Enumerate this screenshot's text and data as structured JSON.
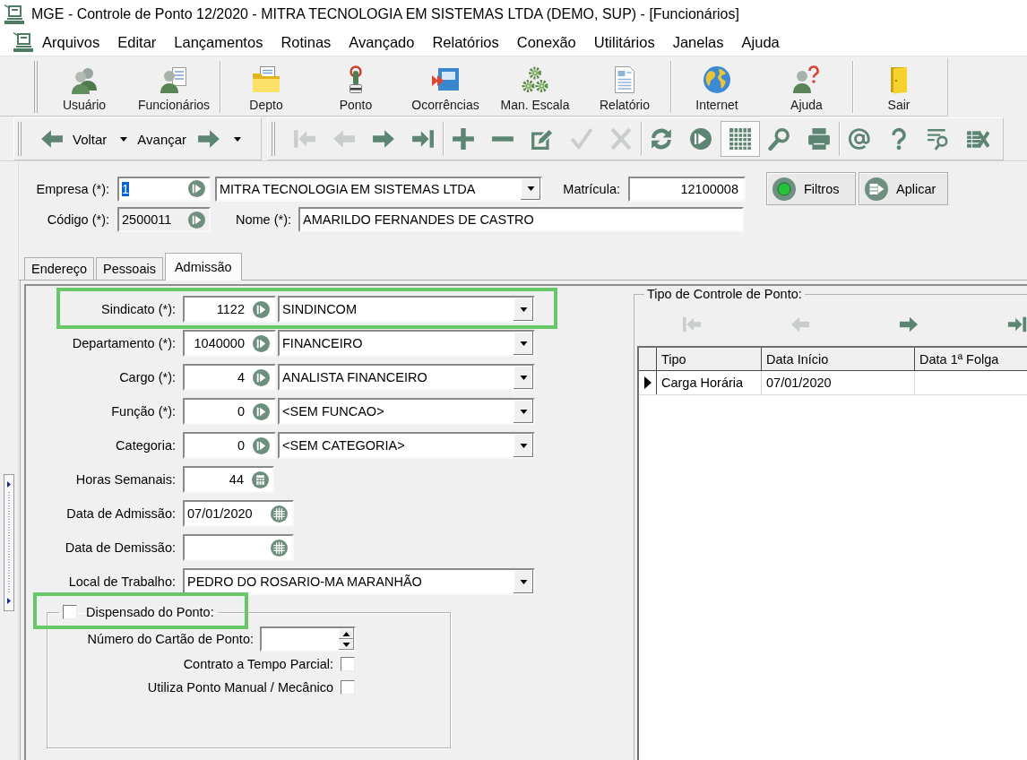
{
  "window": {
    "title": "MGE - Controle de Ponto 12/2020 - MITRA TECNOLOGIA EM SISTEMAS LTDA (DEMO, SUP) - [Funcionários]"
  },
  "menu": [
    "Arquivos",
    "Editar",
    "Lançamentos",
    "Rotinas",
    "Avançado",
    "Relatórios",
    "Conexão",
    "Utilitários",
    "Janelas",
    "Ajuda"
  ],
  "main_toolbar": [
    [
      "Usuário",
      "Funcionários"
    ],
    [
      "Depto",
      "Ponto",
      "Ocorrências",
      "Man. Escala",
      "Relatório"
    ],
    [
      "Internet",
      "Ajuda"
    ],
    [
      "Sair"
    ]
  ],
  "nav_toolbar": {
    "history": [
      {
        "kind": "back",
        "label": "Voltar"
      },
      {
        "kind": "forward",
        "label": "Avançar"
      }
    ],
    "groups": [
      [
        {
          "disabled": true,
          "pressed": false
        },
        {
          "disabled": true,
          "pressed": false
        },
        {
          "disabled": false,
          "pressed": false
        },
        {
          "disabled": false,
          "pressed": false
        }
      ],
      [
        {
          "disabled": false,
          "pressed": false
        },
        {
          "disabled": false,
          "pressed": false
        },
        {
          "disabled": false,
          "pressed": false
        },
        {
          "disabled": true,
          "pressed": false
        },
        {
          "disabled": true,
          "pressed": false
        }
      ],
      [
        {
          "disabled": false,
          "pressed": false
        },
        {
          "disabled": false,
          "pressed": false
        },
        {
          "disabled": false,
          "pressed": true
        },
        {
          "disabled": false,
          "pressed": false
        },
        {
          "disabled": false,
          "pressed": false
        }
      ],
      [
        {
          "disabled": false,
          "pressed": false
        },
        {
          "disabled": false,
          "pressed": false
        },
        {
          "disabled": false,
          "pressed": false
        },
        {
          "disabled": false,
          "pressed": false
        }
      ]
    ]
  },
  "record": {
    "empresa": {
      "label": "Empresa (*):",
      "code": "1",
      "code_selected": true,
      "value": "MITRA TECNOLOGIA EM SISTEMAS LTDA"
    },
    "matricula": {
      "label": "Matrícula:",
      "value": "12100008"
    },
    "codigo": {
      "label": "Código (*):",
      "value": "2500011",
      "readonly": true
    },
    "nome": {
      "label": "Nome (*):",
      "value": "AMARILDO FERNANDES DE CASTRO"
    },
    "buttons": [
      "Filtros",
      "Aplicar"
    ]
  },
  "tabs": [
    {
      "label": "Endereço",
      "selected": false
    },
    {
      "label": "Pessoais",
      "selected": false
    },
    {
      "label": "Admissão",
      "selected": true
    }
  ],
  "admission": {
    "fields": [
      {
        "kind": "lookup",
        "label": "Sindicato (*):",
        "code": "1122",
        "value": "SINDINCOM",
        "highlighted": true
      },
      {
        "kind": "lookup",
        "label": "Departamento (*):",
        "code": "1040000",
        "value": "FINANCEIRO",
        "highlighted": false
      },
      {
        "kind": "lookup",
        "label": "Cargo (*):",
        "code": "4",
        "value": "ANALISTA FINANCEIRO",
        "highlighted": false
      },
      {
        "kind": "lookup",
        "label": "Função (*):",
        "code": "0",
        "value": "<SEM FUNCAO>",
        "highlighted": false
      },
      {
        "kind": "lookup",
        "label": "Categoria:",
        "code": "0",
        "value": "<SEM CATEGORIA>",
        "highlighted": false
      },
      {
        "kind": "number",
        "label": "Horas Semanais:",
        "value": "44",
        "highlighted": false
      },
      {
        "kind": "date",
        "label": "Data de Admissão:",
        "value": "07/01/2020",
        "highlighted": false
      },
      {
        "kind": "date",
        "label": "Data de Demissão:",
        "highlighted": false
      },
      {
        "kind": "combo",
        "label": "Local de Trabalho:",
        "value": "PEDRO DO ROSARIO-MA MARANHÃO",
        "highlighted": false
      }
    ],
    "exemption": {
      "label": "Dispensado do Ponto:",
      "checked": false,
      "highlighted": true,
      "card_label": "Número do Cartão de Ponto:",
      "options": [
        {
          "label": "Contrato a Tempo Parcial:",
          "checked": false
        },
        {
          "label": "Utiliza Ponto Manual / Mecânico",
          "checked": false
        }
      ]
    }
  },
  "point_control": {
    "title": "Tipo de Controle de Ponto:",
    "navigator": [
      {
        "disabled": true
      },
      {
        "disabled": true
      },
      {
        "disabled": false
      },
      {
        "disabled": false
      }
    ],
    "table": {
      "columns": [
        "Tipo",
        "Data Início",
        "Data 1ª Folga"
      ],
      "rows": [
        {
          "selected": true,
          "cells": [
            "Carga Horária",
            "07/01/2020"
          ]
        }
      ]
    }
  }
}
